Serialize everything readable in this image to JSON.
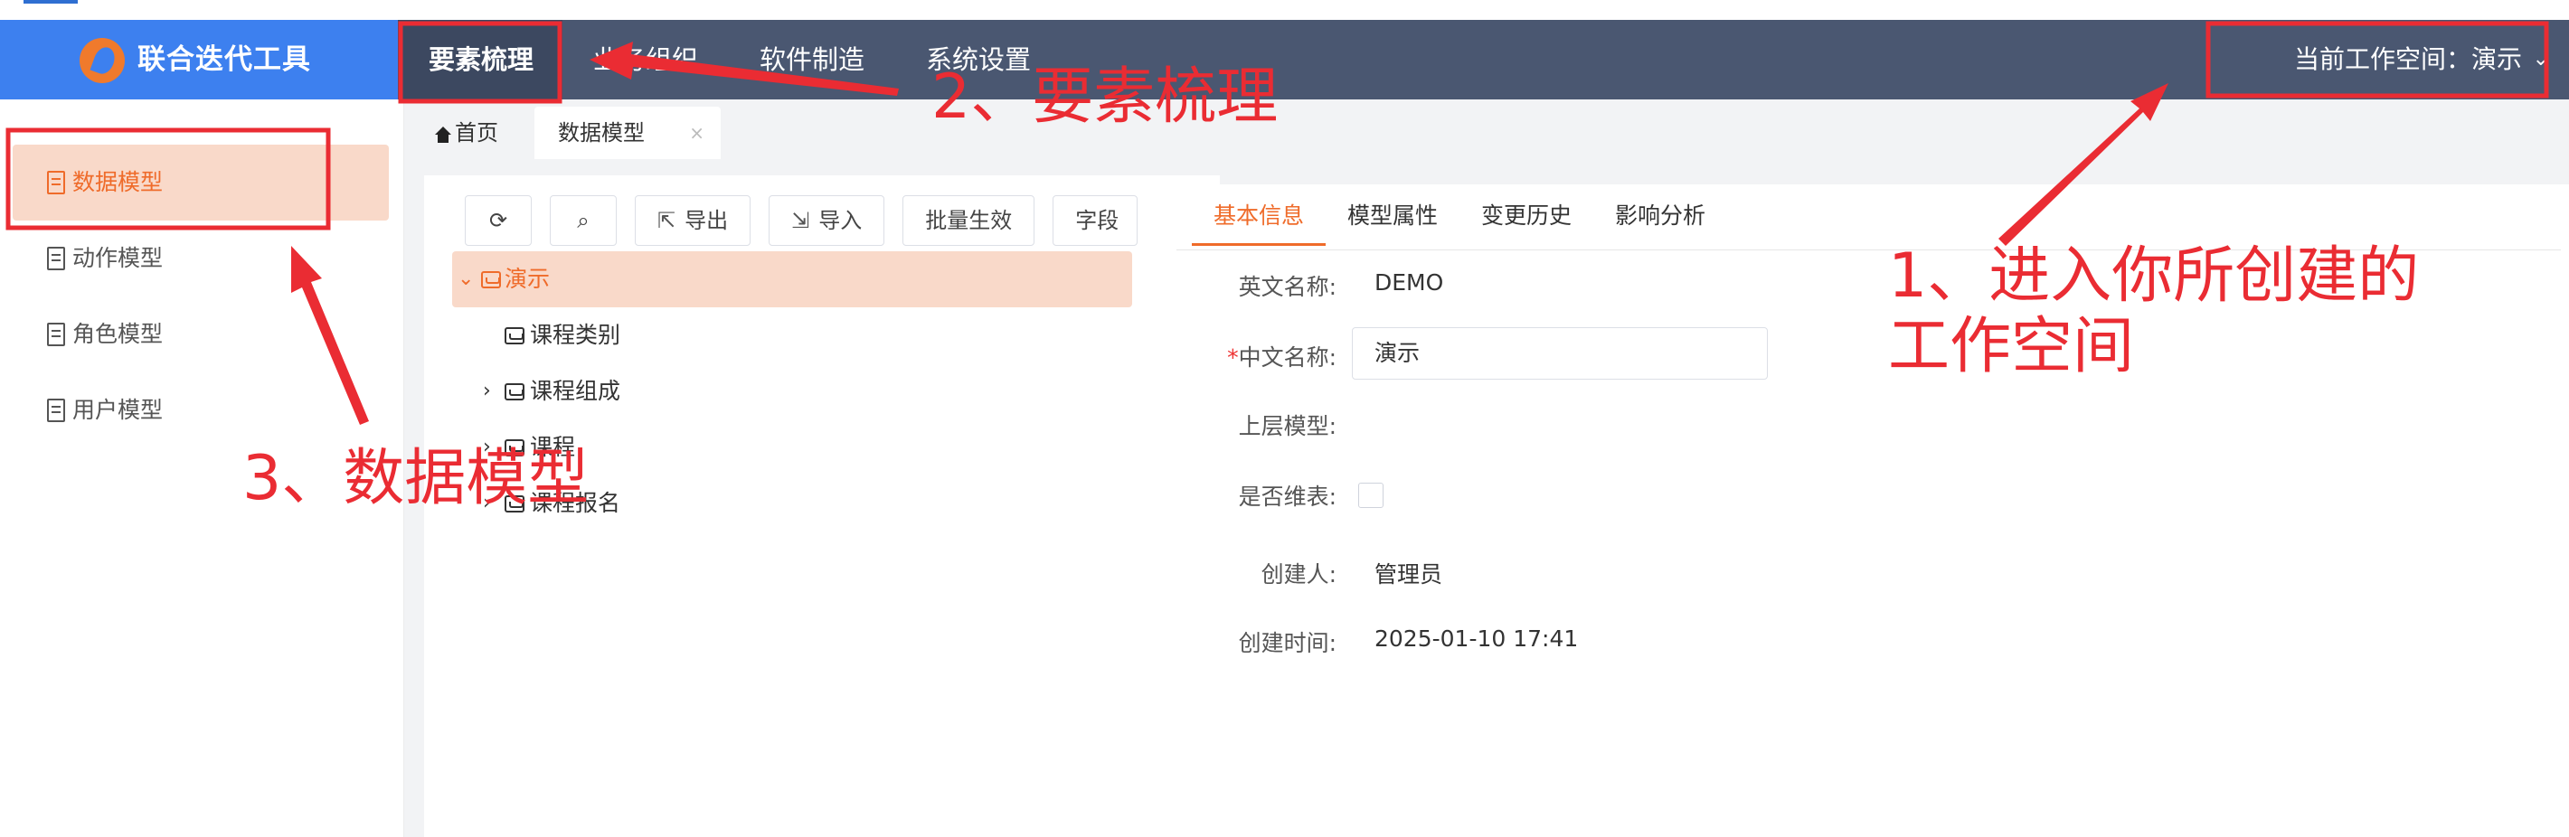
{
  "app": {
    "title": "联合迭代工具",
    "nav": [
      "要素梳理",
      "业务组织",
      "软件制造",
      "系统设置"
    ],
    "workspace_label": "当前工作空间：演示"
  },
  "sidebar": {
    "items": [
      {
        "label": "数据模型",
        "active": true
      },
      {
        "label": "动作模型",
        "active": false
      },
      {
        "label": "角色模型",
        "active": false
      },
      {
        "label": "用户模型",
        "active": false
      }
    ]
  },
  "tabs": {
    "home": "首页",
    "active": "数据模型",
    "close": "×"
  },
  "toolbar": {
    "export": "导出",
    "import": "导入",
    "batch": "批量生效",
    "field": "字段"
  },
  "tree": {
    "root": "演示",
    "children": [
      "课程类别",
      "课程组成",
      "课程",
      "课程报名"
    ]
  },
  "detail": {
    "tabs": [
      "基本信息",
      "模型属性",
      "变更历史",
      "影响分析"
    ],
    "fields": {
      "en_name_label": "英文名称:",
      "en_name_value": "DEMO",
      "cn_name_label": "中文名称:",
      "cn_name_value": "演示",
      "parent_label": "上层模型:",
      "is_dim_label": "是否维表:",
      "creator_label": "创建人:",
      "creator_value": "管理员",
      "created_label": "创建时间:",
      "created_value": "2025-01-10 17:41"
    }
  },
  "annotations": {
    "a1_line1": "1、进入你所创建的",
    "a1_line2": "工作空间",
    "a2": "2、要素梳理",
    "a3": "3、数据模型",
    "color": "#ea2c33"
  }
}
